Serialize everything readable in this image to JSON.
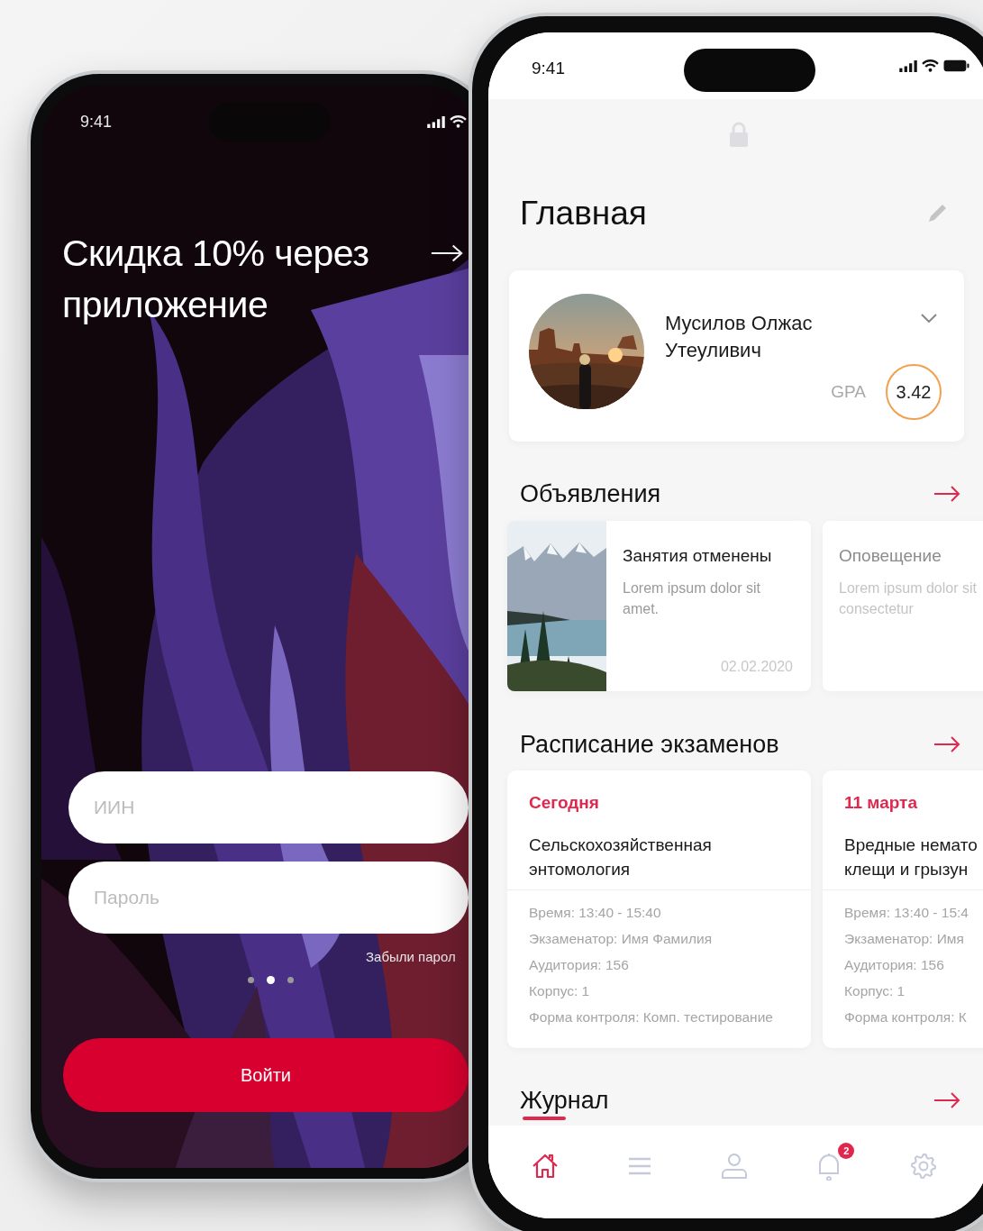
{
  "login_screen": {
    "status_bar": {
      "time": "9:41"
    },
    "promo": {
      "title": "Скидка 10% через приложение"
    },
    "fields": [
      {
        "placeholder": "ИИН"
      },
      {
        "placeholder": "Пароль"
      }
    ],
    "forgot_link": "Забыли парол",
    "pager": [
      {
        "selected": false
      },
      {
        "selected": true
      },
      {
        "selected": false
      }
    ],
    "login_button": "Войти"
  },
  "home_screen": {
    "status_bar": {
      "time": "9:41"
    },
    "title": "Главная",
    "profile": {
      "name": "Мусилов Олжас Утеуливич",
      "gpa_label": "GPA",
      "gpa": "3.42"
    },
    "announcements": {
      "title": "Объявления",
      "items": [
        {
          "kind": "picture",
          "title": "Занятия отменены",
          "text": "Lorem ipsum dolor sit amet.",
          "date": "02.02.2020"
        },
        {
          "kind": "plain",
          "title": "Оповещение",
          "text": "Lorem ipsum dolor sit consectetur"
        }
      ]
    },
    "exams": {
      "title": "Расписание экзаменов",
      "items": [
        {
          "date": "Сегодня",
          "subject_lines": [
            "Сельскохозяйственная",
            "энтомология"
          ],
          "details": [
            "Время: 13:40 - 15:40",
            "Экзаменатор: Имя Фамилия",
            "Аудитория: 156",
            "Корпус: 1",
            "Форма контроля: Комп. тестирование"
          ]
        },
        {
          "date": "11 марта",
          "subject_lines": [
            "Вредные немато",
            "клещи и грызун"
          ],
          "details": [
            "Время: 13:40 - 15:4",
            "Экзаменатор: Имя",
            "Аудитория: 156",
            "Корпус: 1",
            "Форма контроля: К"
          ]
        }
      ]
    },
    "journal": {
      "title": "Журнал"
    },
    "nav": [
      {
        "kind": "home",
        "selected": true
      },
      {
        "kind": "menu",
        "selected": false
      },
      {
        "kind": "profile",
        "selected": false
      },
      {
        "kind": "notifications",
        "selected": false,
        "badge": "2"
      },
      {
        "kind": "settings",
        "selected": false
      }
    ]
  }
}
